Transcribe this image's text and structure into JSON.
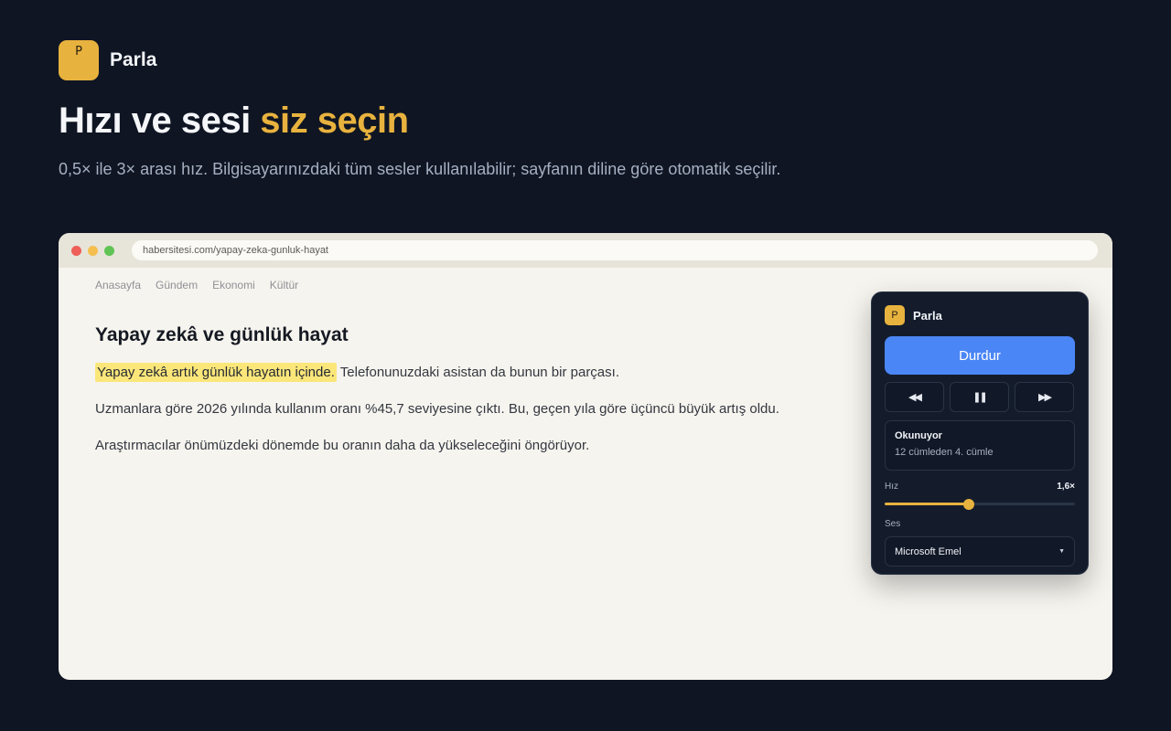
{
  "brand": {
    "logo_letter": "P",
    "name": "Parla",
    "accent_color": "#e8b23e"
  },
  "hero": {
    "title_plain": "Hızı ve sesi ",
    "title_accent": "siz seçin",
    "subtitle": "0,5× ile 3× arası hız. Bilgisayarınızdaki tüm sesler kullanılabilir; sayfanın diline göre otomatik seçilir."
  },
  "browser": {
    "url": "habersitesi.com/yapay-zeka-gunluk-hayat",
    "nav": [
      "Anasayfa",
      "Gündem",
      "Ekonomi",
      "Kültür"
    ],
    "article": {
      "title": "Yapay zekâ ve günlük hayat",
      "p1_highlight": "Yapay zekâ artık günlük hayatın içinde.",
      "p1_rest": " Telefonunuzdaki asistan da bunun bir parçası.",
      "p2": "Uzmanlara göre 2026 yılında kullanım oranı %45,7 seviyesine çıktı. Bu, geçen yıla göre üçüncü büyük artış oldu.",
      "p3": "Araştırmacılar önümüzdeki dönemde bu oranın daha da yükseleceğini öngörüyor."
    }
  },
  "panel": {
    "logo_letter": "P",
    "title": "Parla",
    "stop_label": "Durdur",
    "controls": {
      "rewind": "◀◀",
      "pause": "❚❚",
      "forward": "▶▶"
    },
    "status": {
      "title": "Okunuyor",
      "text": "12 cümleden 4. cümle"
    },
    "speed": {
      "label": "Hız",
      "value_text": "1,6×",
      "value": 1.6,
      "min": 0.5,
      "max": 3
    },
    "voice": {
      "label": "Ses",
      "selected": "Microsoft Emel"
    },
    "button_color": "#4a86f5"
  }
}
